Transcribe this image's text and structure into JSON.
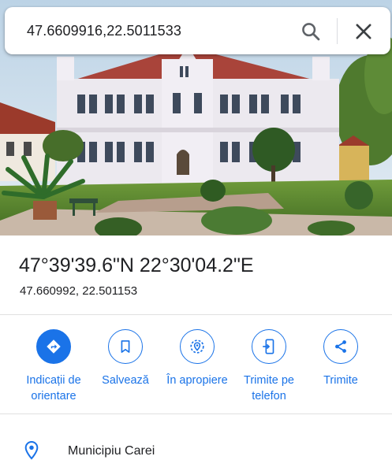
{
  "search": {
    "query": "47.6609916,22.5011533"
  },
  "photo": {
    "description_icon": "street-photo"
  },
  "location": {
    "dms": "47°39'39.6\"N 22°30'04.2\"E",
    "decimal": "47.660992, 22.501153"
  },
  "actions": [
    {
      "label": "Indicații de orientare",
      "icon": "directions-icon"
    },
    {
      "label": "Salvează",
      "icon": "bookmark-icon"
    },
    {
      "label": "În apropiere",
      "icon": "nearby-icon"
    },
    {
      "label": "Trimite pe telefon",
      "icon": "send-to-phone-icon"
    },
    {
      "label": "Trimite",
      "icon": "share-icon"
    }
  ],
  "place": {
    "label": "Municipiu Carei",
    "icon": "location-pin-icon"
  },
  "colors": {
    "accent": "#1a73e8",
    "text": "#202124",
    "divider": "#e0e0e0"
  }
}
